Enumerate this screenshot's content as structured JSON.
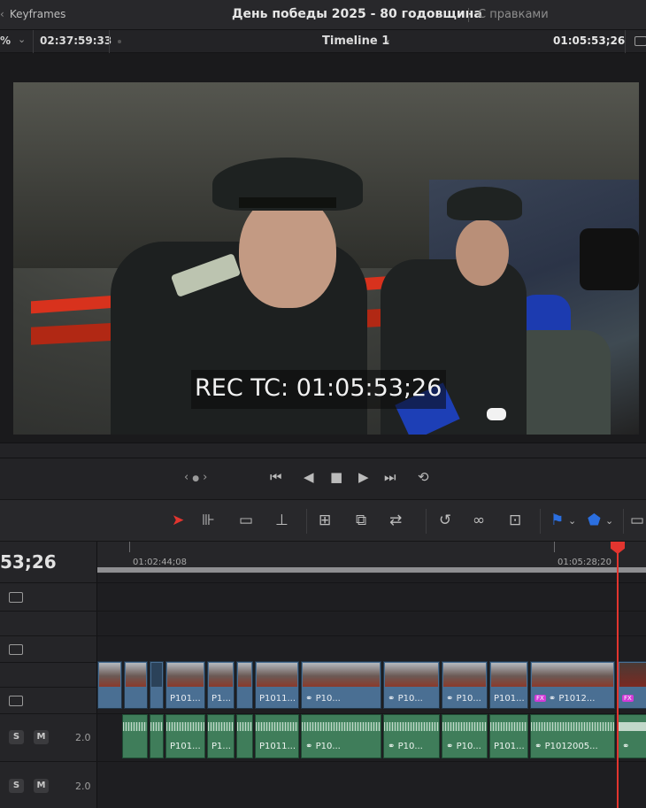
{
  "topbar": {
    "keyframes_label": "Keyframes",
    "project_title": "День победы 2025 - 80 годовщина",
    "status": "С правками"
  },
  "viewer_header": {
    "zoom": "%",
    "source_timecode": "02:37:59:33",
    "timeline_name": "Timeline 1",
    "record_timecode": "01:05:53;26"
  },
  "viewer": {
    "overlay_text": "REC TC: 01:05:53;26"
  },
  "transport": {
    "prev_label": "‹",
    "dot_label": "●",
    "next_label": "›"
  },
  "timeline": {
    "current_timecode": "53;26",
    "ruler_ticks": [
      "01:02:44;08",
      "01:05:28;20"
    ],
    "audio_tracks": [
      {
        "solo": "S",
        "mute": "M",
        "channels": "2.0"
      },
      {
        "solo": "S",
        "mute": "M",
        "channels": "2.0"
      }
    ],
    "video_clips": [
      "P101...",
      "P1...",
      "P1011...",
      "P10...",
      "P10...",
      "P10...",
      "P101...",
      "P1012..."
    ],
    "fx_badge": "FX",
    "audio_clips": [
      "P101...",
      "P1...",
      "P1011...",
      "P10...",
      "P10...",
      "P10...",
      "P101...",
      "P1012005..."
    ]
  },
  "colors": {
    "playhead": "#e2352f",
    "video_clip": "#4a6f93",
    "audio_clip": "#3f7d5a",
    "select_tool": "#e2352f",
    "flag_blue": "#2b6fe0"
  }
}
